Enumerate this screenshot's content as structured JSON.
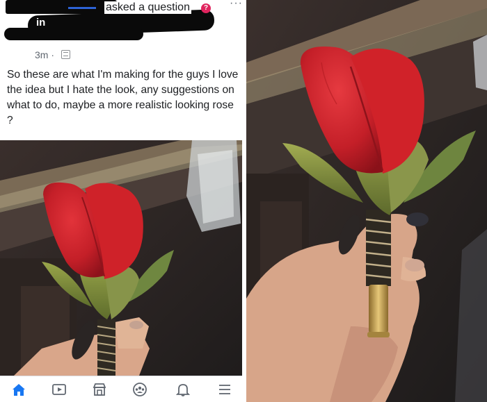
{
  "post": {
    "asked_text": "asked a question",
    "question_badge": "?",
    "in_text": "in",
    "time": "3m ·",
    "more": "···",
    "body": "So these are what I'm making for the guys I love the idea but I hate the look, any suggestions on what to do, maybe a more realistic looking rose ?"
  },
  "nav": {
    "items": [
      "home-icon",
      "video-icon",
      "marketplace-icon",
      "groups-icon",
      "notifications-icon",
      "menu-icon"
    ],
    "active": "home-icon"
  },
  "colors": {
    "facebook_blue": "#1877f2",
    "rose_red": "#c8202a",
    "leaf_green": "#7d8f3a",
    "counter_dark": "#2b2523",
    "question_badge": "#e0245e"
  },
  "images": {
    "left_photo": "red-fabric-rose-boutonniere-photo",
    "right_photo": "hand-holding-rose-boutonniere-photo"
  }
}
